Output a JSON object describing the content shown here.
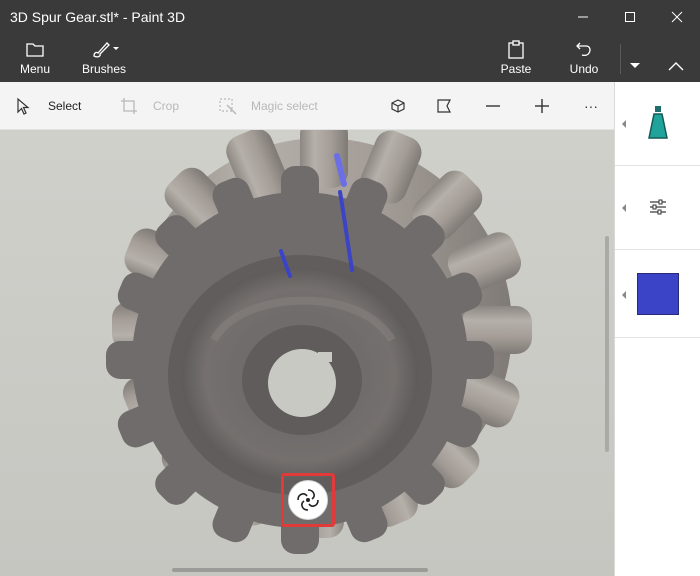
{
  "window": {
    "title": "3D Spur Gear.stl* - Paint 3D",
    "controls": [
      "minimize",
      "maximize",
      "close"
    ]
  },
  "ribbon": {
    "menu_label": "Menu",
    "brushes_label": "Brushes",
    "paste_label": "Paste",
    "undo_label": "Undo"
  },
  "toolbar": {
    "select_label": "Select",
    "crop_label": "Crop",
    "magic_select_label": "Magic select",
    "more_label": "···"
  },
  "side_panel": {
    "active_brush": "marker",
    "selected_color": "#3b44c6"
  },
  "canvas": {
    "background": "#cbcbc6",
    "model": "spur-gear",
    "model_color": "#6f6c6b",
    "highlight_button": "rotate"
  },
  "colors": {
    "chrome": "#3a3a3a",
    "toolbar": "#f4f4f4",
    "highlight": "#e03a3a",
    "stroke": "#3b44c6"
  }
}
